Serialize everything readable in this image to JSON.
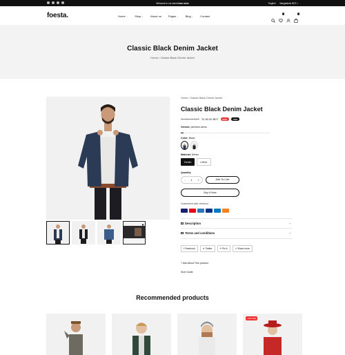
{
  "topbar": {
    "announce_text": "Welcome to our store",
    "announce_link": "learn more",
    "language": "English",
    "currency": "Bangladesh BDT ৳"
  },
  "header": {
    "logo": "foesta.",
    "nav": [
      {
        "label": "Home",
        "dropdown": true
      },
      {
        "label": "Shop",
        "dropdown": true
      },
      {
        "label": "About us",
        "dropdown": false
      },
      {
        "label": "Pages",
        "dropdown": true
      },
      {
        "label": "Blog",
        "dropdown": true
      },
      {
        "label": "Contact",
        "dropdown": false
      }
    ],
    "wishlist_count": "0",
    "cart_count": "0"
  },
  "hero": {
    "title": "Classic Black Denim Jacket",
    "breadcrumb_home": "Home",
    "breadcrumb_sep": "•",
    "breadcrumb_current": "Classic Black Denim Jacket"
  },
  "product": {
    "breadcrumb_home": "Home",
    "breadcrumb_sep": "•",
    "breadcrumb_current": "Classic Black Denim Jacket",
    "title": "Classic Black Denim Jacket",
    "old_price": "Tk 100.00 BDT",
    "price": "Tk 50.00 BDT",
    "sale_badge": "Sale!",
    "discount_badge": "-50%",
    "vendor_label": "Vendor:",
    "vendor": "partners-demo",
    "stock_fraction": 0.03,
    "color_label": "Color:",
    "color_value": "Black",
    "material_label": "Material:",
    "material_value": "Denim",
    "materials": [
      "Denim",
      "Lether"
    ],
    "quantity_label": "Quantity",
    "quantity": "1",
    "minus": "-",
    "plus": "+",
    "add_to_cart": "Add To Cart",
    "buy_now": "Buy it Now",
    "checkout_label": "Guaranteed safe checkout",
    "payments": [
      {
        "name": "visa-icon",
        "color": "#1a1f71"
      },
      {
        "name": "mastercard-icon",
        "color": "#eb001b"
      },
      {
        "name": "amex-icon",
        "color": "#2e77bb"
      },
      {
        "name": "paypal-icon",
        "color": "#003087"
      },
      {
        "name": "diners-icon",
        "color": "#0079be"
      },
      {
        "name": "discover-icon",
        "color": "#f58220"
      }
    ],
    "description_label": "Description",
    "terms_label": "Terms and conditions",
    "share": [
      "Facebook",
      "Twitter",
      "Pin it",
      "Share more"
    ],
    "ask_label": "Ask About This product",
    "size_guide": "Size Guide"
  },
  "recommended": {
    "title": "Recommended products",
    "cards": [
      {
        "tag": ""
      },
      {
        "tag": ""
      },
      {
        "tag": ""
      },
      {
        "tag": "-13% sale"
      }
    ]
  },
  "colors": {
    "sale": "#e03a3a",
    "dark": "#111111",
    "hero_bg": "#f3f3f3"
  }
}
